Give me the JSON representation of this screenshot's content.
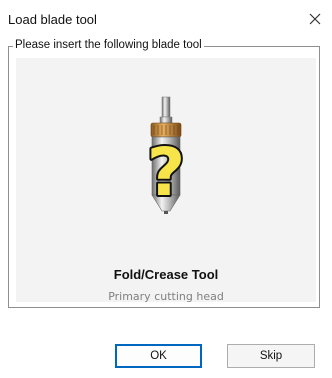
{
  "window": {
    "title": "Load blade tool"
  },
  "group": {
    "legend": "Please insert the following blade tool"
  },
  "tool": {
    "name": "Fold/Crease Tool",
    "subtitle": "Primary cutting head"
  },
  "buttons": {
    "ok": "OK",
    "skip": "Skip"
  },
  "colors": {
    "accent": "#0067c0",
    "question_mark": "#f6e44a"
  },
  "icons": {
    "close": "close-icon",
    "tool": "blade-tool-icon",
    "unknown": "question-mark-icon"
  }
}
